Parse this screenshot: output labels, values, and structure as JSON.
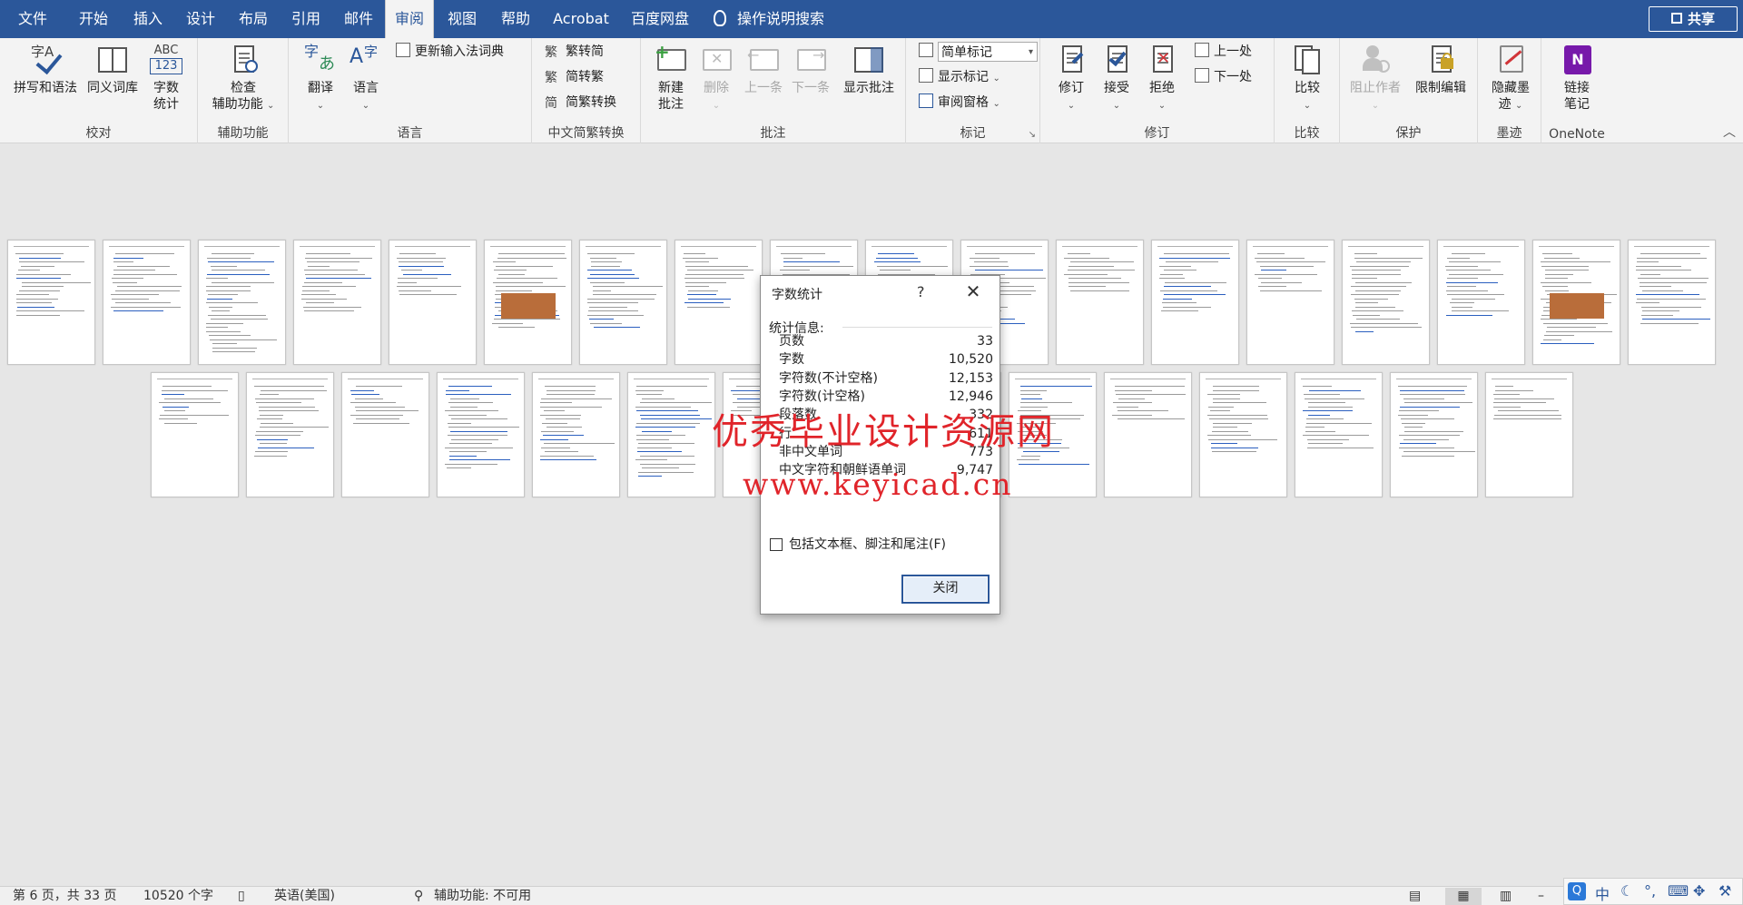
{
  "menubar": {
    "tabs": [
      "文件",
      "开始",
      "插入",
      "设计",
      "布局",
      "引用",
      "邮件",
      "审阅",
      "视图",
      "帮助",
      "Acrobat",
      "百度网盘"
    ],
    "active_tab": "审阅",
    "tell_me": "操作说明搜索",
    "share": "共享"
  },
  "ribbon": {
    "proofing": {
      "label": "校对",
      "spelling": "拼写和语法",
      "thesaurus": "同义词库",
      "wordcount_line1": "字数",
      "wordcount_line2": "统计",
      "wordcount_icon_text1": "ABC",
      "wordcount_icon_text2": "123"
    },
    "accessibility": {
      "label": "辅助功能",
      "check_line1": "检查",
      "check_line2": "辅助功能"
    },
    "language": {
      "label": "语言",
      "translate": "翻译",
      "language": "语言",
      "update_ime": "更新输入法词典"
    },
    "chinese_conversion": {
      "label": "中文简繁转换",
      "to_traditional": "繁转简",
      "to_simplified": "简转繁",
      "convert": "简繁转换"
    },
    "comments": {
      "label": "批注",
      "new_line1": "新建",
      "new_line2": "批注",
      "delete": "删除",
      "previous": "上一条",
      "next": "下一条",
      "show": "显示批注"
    },
    "tracking": {
      "label": "标记",
      "markup_select": "简单标记",
      "show_markup": "显示标记",
      "review_pane": "审阅窗格"
    },
    "changes": {
      "label": "修订",
      "track": "修订",
      "accept": "接受",
      "reject": "拒绝",
      "previous": "上一处",
      "next": "下一处"
    },
    "compare": {
      "label": "比较",
      "compare": "比较"
    },
    "protect": {
      "label": "保护",
      "block_authors": "阻止作者",
      "restrict_editing": "限制编辑"
    },
    "ink": {
      "label": "墨迹",
      "hide_line1": "隐藏墨",
      "hide_line2": "迹"
    },
    "onenote": {
      "label": "OneNote",
      "link_line1": "链接",
      "link_line2": "笔记"
    }
  },
  "dialog": {
    "title": "字数统计",
    "help": "?",
    "stats_label": "统计信息:",
    "stats": [
      {
        "label": "页数",
        "value": "33"
      },
      {
        "label": "字数",
        "value": "10,520"
      },
      {
        "label": "字符数(不计空格)",
        "value": "12,153"
      },
      {
        "label": "字符数(计空格)",
        "value": "12,946"
      },
      {
        "label": "段落数",
        "value": "332"
      },
      {
        "label": "行",
        "value": "611"
      },
      {
        "label": "非中文单词",
        "value": "773"
      },
      {
        "label": "中文字符和朝鲜语单词",
        "value": "9,747"
      }
    ],
    "include_label": "包括文本框、脚注和尾注(F)",
    "include_checked": false,
    "close_button": "关闭"
  },
  "watermark": {
    "line1": "优秀毕业设计资源网",
    "line2": "www.keyicad.cn",
    "color": "#e0242a"
  },
  "statusbar": {
    "page": "第 6 页，共 33 页",
    "words": "10520 个字",
    "language": "英语(美国)",
    "accessibility": "辅助功能: 不可用"
  },
  "ime": {
    "mode": "中"
  },
  "colors": {
    "brand": "#2b579a",
    "ribbon_bg": "#f3f3f3",
    "doc_bg": "#e6e6e6"
  }
}
